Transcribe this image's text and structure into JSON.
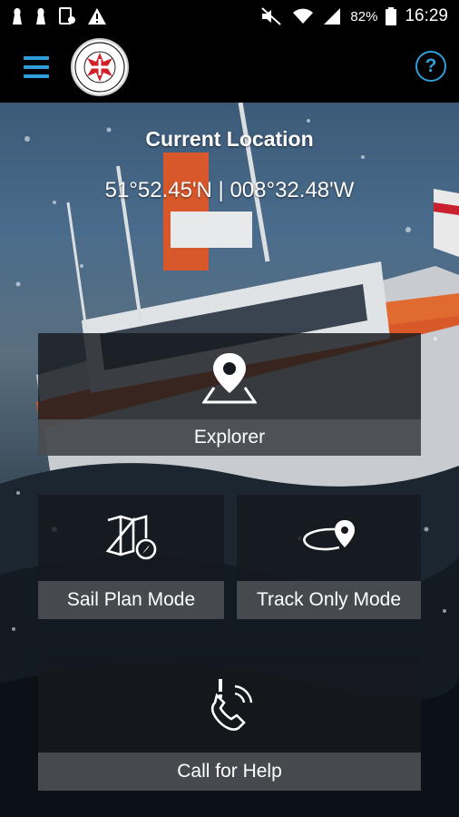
{
  "status_bar": {
    "battery_percent": "82%",
    "time": "16:29",
    "icons": [
      "notification-icon",
      "notification-icon",
      "sim-icon",
      "warning-icon",
      "mute-icon",
      "wifi-icon",
      "signal-icon",
      "battery-icon"
    ]
  },
  "app_bar": {
    "logo_text": "DIE SEENOTRETTER · DGzRS",
    "help_label": "?"
  },
  "location": {
    "title": "Current Location",
    "coordinates": "51°52.45'N | 008°32.48'W"
  },
  "tiles": {
    "explorer": {
      "label": "Explorer",
      "icon": "map-pin-icon"
    },
    "sail_plan": {
      "label": "Sail Plan Mode",
      "icon": "map-compass-icon"
    },
    "track_only": {
      "label": "Track Only Mode",
      "icon": "track-pin-icon"
    },
    "call_help": {
      "label": "Call for Help",
      "icon": "phone-alert-icon"
    }
  },
  "colors": {
    "accent": "#2e9fd8",
    "tile_bg": "#161a1e",
    "label_bar": "#55585c"
  }
}
